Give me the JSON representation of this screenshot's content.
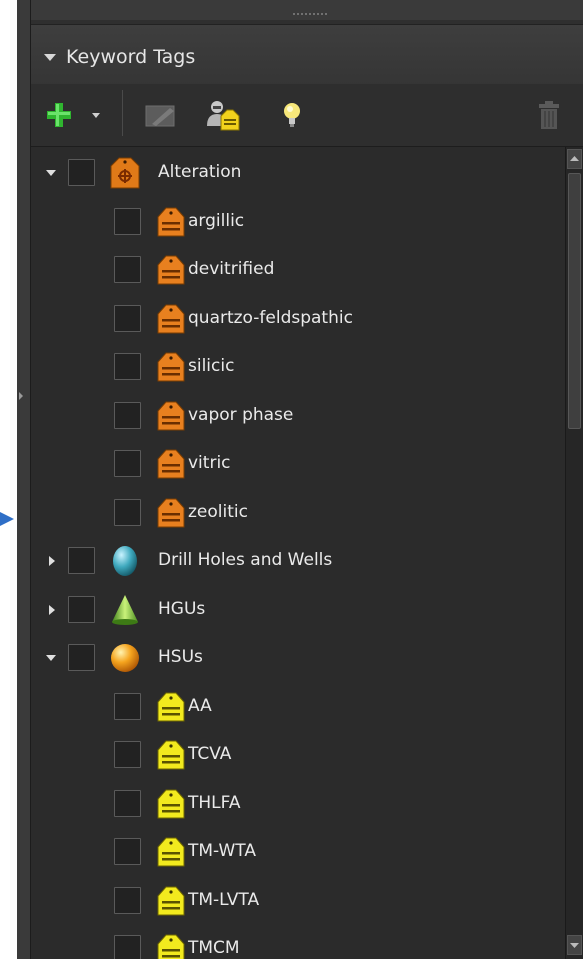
{
  "panel": {
    "title": "Keyword Tags"
  },
  "toolbar": {
    "items": [
      "add-icon",
      "dropdown-arrow-icon",
      "edit-icon",
      "user-tag-icon",
      "lightbulb-icon",
      "trash-icon"
    ]
  },
  "tree": {
    "rows": [
      {
        "label": "Alteration",
        "level": 0,
        "expanded": true,
        "icon": "orange-category-tag-icon"
      },
      {
        "label": "argillic",
        "level": 1,
        "icon": "orange-tag-icon"
      },
      {
        "label": "devitrified",
        "level": 1,
        "icon": "orange-tag-icon"
      },
      {
        "label": "quartzo-feldspathic",
        "level": 1,
        "icon": "orange-tag-icon"
      },
      {
        "label": "silicic",
        "level": 1,
        "icon": "orange-tag-icon"
      },
      {
        "label": "vapor phase",
        "level": 1,
        "icon": "orange-tag-icon"
      },
      {
        "label": "vitric",
        "level": 1,
        "icon": "orange-tag-icon"
      },
      {
        "label": "zeolitic",
        "level": 1,
        "icon": "orange-tag-icon"
      },
      {
        "label": "Drill Holes and Wells",
        "level": 0,
        "expanded": false,
        "icon": "cyan-capsule-icon"
      },
      {
        "label": "HGUs",
        "level": 0,
        "expanded": false,
        "icon": "green-cone-icon"
      },
      {
        "label": "HSUs",
        "level": 0,
        "expanded": true,
        "icon": "orange-sphere-icon"
      },
      {
        "label": "AA",
        "level": 1,
        "icon": "yellow-tag-icon"
      },
      {
        "label": "TCVA",
        "level": 1,
        "icon": "yellow-tag-icon"
      },
      {
        "label": "THLFA",
        "level": 1,
        "icon": "yellow-tag-icon"
      },
      {
        "label": "TM-WTA",
        "level": 1,
        "icon": "yellow-tag-icon"
      },
      {
        "label": "TM-LVTA",
        "level": 1,
        "icon": "yellow-tag-icon"
      },
      {
        "label": "TMCM",
        "level": 1,
        "icon": "yellow-tag-icon"
      }
    ]
  },
  "colors": {
    "accent_add": "#33cc33",
    "tag_orange": "#e8801f",
    "tag_yellow": "#f2ea1e",
    "pointer_blue": "#2f6fc7"
  }
}
